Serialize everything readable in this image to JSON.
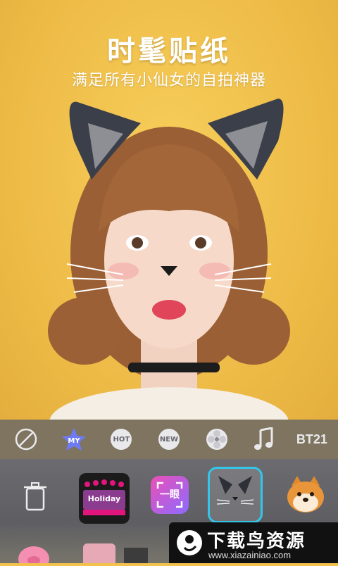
{
  "promo": {
    "headline": "时髦贴纸",
    "subline": "满足所有小仙女的自拍神器"
  },
  "tabs": [
    {
      "name": "none",
      "label": ""
    },
    {
      "name": "my",
      "label": "MY"
    },
    {
      "name": "hot",
      "label": "HOT"
    },
    {
      "name": "new",
      "label": "NEW"
    },
    {
      "name": "flower",
      "label": ""
    },
    {
      "name": "music",
      "label": ""
    },
    {
      "name": "bt21",
      "label": "BT21"
    }
  ],
  "stickers": {
    "holiday_label": "Holiday",
    "glance_label": "一眼"
  },
  "watermark": {
    "brand": "下载鸟资源",
    "url": "www.xiazainiao.com"
  },
  "colors": {
    "background": "#F2C14E",
    "accent_selected": "#35C5E8",
    "my_star": "#6E7BF2"
  }
}
